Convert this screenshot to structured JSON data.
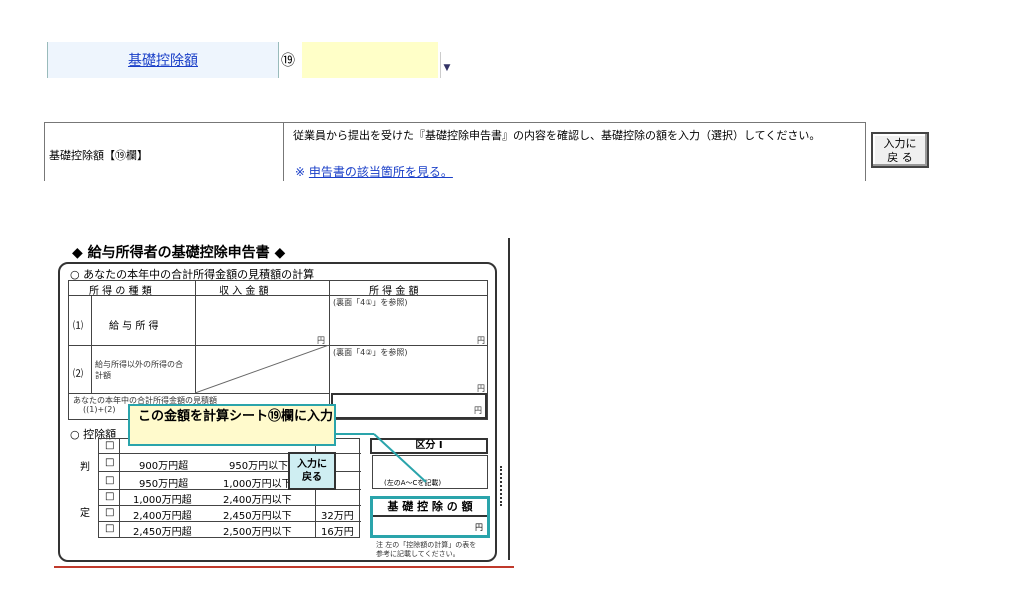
{
  "top_row": {
    "label": "基礎控除額",
    "number": "⑲",
    "input_value": "",
    "dropdown_arrow": "▼"
  },
  "help": {
    "label": "基礎控除額【⑲欄】",
    "text": "従業員から提出を受けた『基礎控除申告書』の内容を確認し、基礎控除の額を入力（選択）してください。",
    "note_mark": "※",
    "note_link": "申告書の該当箇所を見る。",
    "back_button": [
      "入力に",
      "戻 る"
    ]
  },
  "form": {
    "title": "◆ 給与所得者の基礎控除申告書 ◆",
    "section1": "○ あなたの本年中の合計所得金額の見積額の計算",
    "headers": [
      "所 得 の 種 類",
      "収 入 金 額",
      "所 得 金 額"
    ],
    "rows": [
      {
        "num": "⑴",
        "label": "給 与 所 得",
        "note": "(裏面「4①」を参照)"
      },
      {
        "num": "⑵",
        "label": "給与所得以外の所得の合計額",
        "note": "(裏面「4②」を参照)"
      }
    ],
    "yen": "円",
    "total_label": "あなたの本年中の合計所得金額の見積額",
    "total_sub": "((1)+(2)",
    "section2": "○ 控除額",
    "judge_left": [
      "判",
      "定"
    ],
    "checkbox": "□",
    "judge_rows": [
      {
        "from": "900万円超",
        "to": "950万円以下",
        "amount": ""
      },
      {
        "from": "950万円超",
        "to": "1,000万円以下",
        "amount": ""
      },
      {
        "from": "1,000万円超",
        "to": "2,400万円以下",
        "amount": ""
      },
      {
        "from": "2,400万円超",
        "to": "2,450万円以下",
        "amount": "32万円"
      },
      {
        "from": "2,450万円超",
        "to": "2,500万円以下",
        "amount": "16万円"
      }
    ],
    "kubun_title": "区分 I",
    "kubun_note": "(左のA～Cを記載)",
    "kiso_title": "基 礎 控 除 の 額",
    "bottom_note": [
      "注 左の「控除額の計算」の表を",
      "参考に記載してください。"
    ],
    "callout": "この金額を計算シート⑲欄に入力",
    "back_button": [
      "入力に",
      "戻る"
    ]
  }
}
